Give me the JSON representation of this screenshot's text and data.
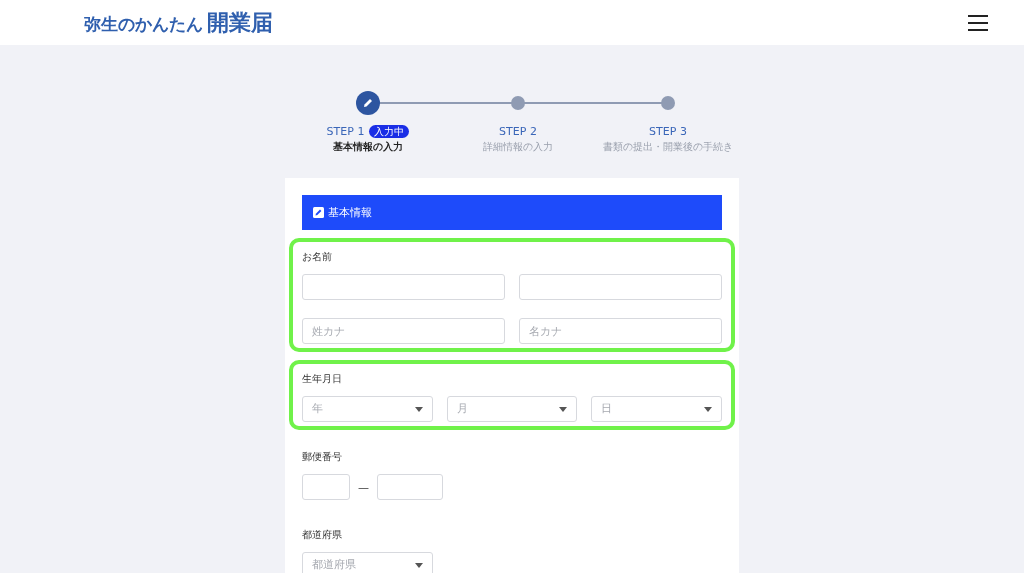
{
  "header": {
    "logo_main": "弥生のかんたん",
    "logo_accent": "開業届"
  },
  "steps": [
    {
      "label": "STEP 1",
      "badge": "入力中",
      "caption": "基本情報の入力",
      "selected": true
    },
    {
      "label": "STEP 2",
      "caption": "詳細情報の入力",
      "selected": false
    },
    {
      "label": "STEP 3",
      "caption": "書類の提出・開業後の手続き",
      "selected": false
    }
  ],
  "form": {
    "section_title": "基本情報",
    "groups": [
      {
        "kind": "name",
        "label": "お名前",
        "highlighted": true,
        "rows": [
          [
            {
              "kind": "input"
            },
            {
              "kind": "input"
            }
          ],
          [
            {
              "kind": "input",
              "placeholder": "姓カナ"
            },
            {
              "kind": "input",
              "placeholder": "名カナ"
            }
          ]
        ]
      },
      {
        "kind": "date",
        "label": "生年月日",
        "highlighted": true,
        "rows": [
          [
            {
              "kind": "select",
              "placeholder": "年"
            },
            {
              "kind": "select",
              "placeholder": "月"
            },
            {
              "kind": "select",
              "placeholder": "日"
            }
          ]
        ]
      },
      {
        "kind": "postal",
        "label": "郵便番号",
        "highlighted": false,
        "rows": [
          [
            {
              "kind": "input"
            },
            {
              "kind": "dash",
              "text": "—"
            },
            {
              "kind": "input"
            }
          ]
        ]
      },
      {
        "kind": "prefecture",
        "label": "都道府県",
        "highlighted": false,
        "rows": [
          [
            {
              "kind": "select",
              "placeholder": "都道府県"
            }
          ]
        ]
      }
    ]
  }
}
